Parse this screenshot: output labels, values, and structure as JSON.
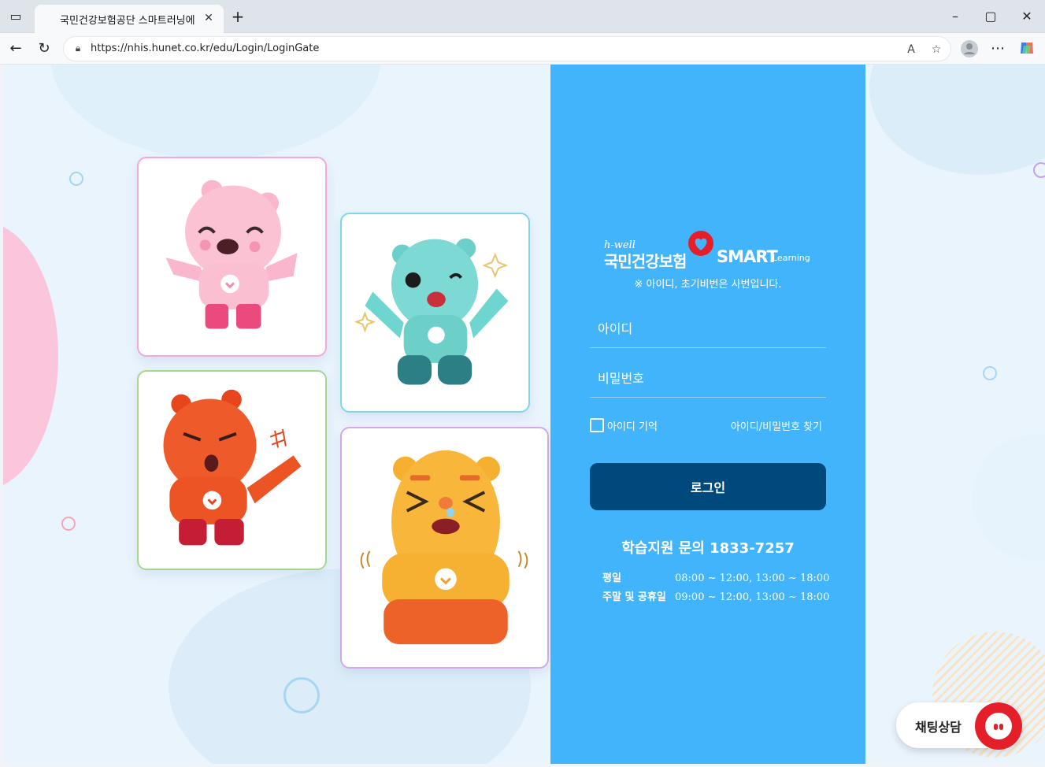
{
  "browser": {
    "tab_title": "국민건강보험공단 스마트러닝에",
    "url": "https://nhis.hunet.co.kr/edu/Login/LoginGate",
    "icons": [
      "sidebar-icon",
      "close-icon",
      "plus-icon",
      "back-icon",
      "refresh-icon",
      "lock-icon",
      "read-aloud-icon",
      "favorite-icon",
      "profile-icon",
      "more-icon",
      "copilot-icon",
      "minimize-icon",
      "maximize-icon",
      "close-window-icon"
    ]
  },
  "logo": {
    "small": "h-well",
    "title": "국민건강보험",
    "smart": "SMART",
    "learning": "Learning"
  },
  "login": {
    "notice": "※ 아이디, 초기비번은 사번입니다.",
    "id_placeholder": "아이디",
    "password_placeholder": "비밀번호",
    "remember_label": "아이디 기억",
    "find_label": "아이디/비밀번호 찾기",
    "login_button": "로그인"
  },
  "support": {
    "title": "학습지원 문의 1833-7257",
    "weekday_label": "평일",
    "weekday_hours": "08:00 ~ 12:00, 13:00 ~ 18:00",
    "weekend_label": "주말 및 공휴일",
    "weekend_hours": "09:00 ~ 12:00, 13:00 ~ 18:00"
  },
  "chat": {
    "label": "채팅상담"
  },
  "colors": {
    "panel": "#42b4fb",
    "button": "#00497c",
    "chat_red": "#e41f2a",
    "pink_card": "#f48fc0",
    "mint_card": "#6fd7e6",
    "red_card": "#9ad27a",
    "orange_card": "#c8a0e6"
  }
}
